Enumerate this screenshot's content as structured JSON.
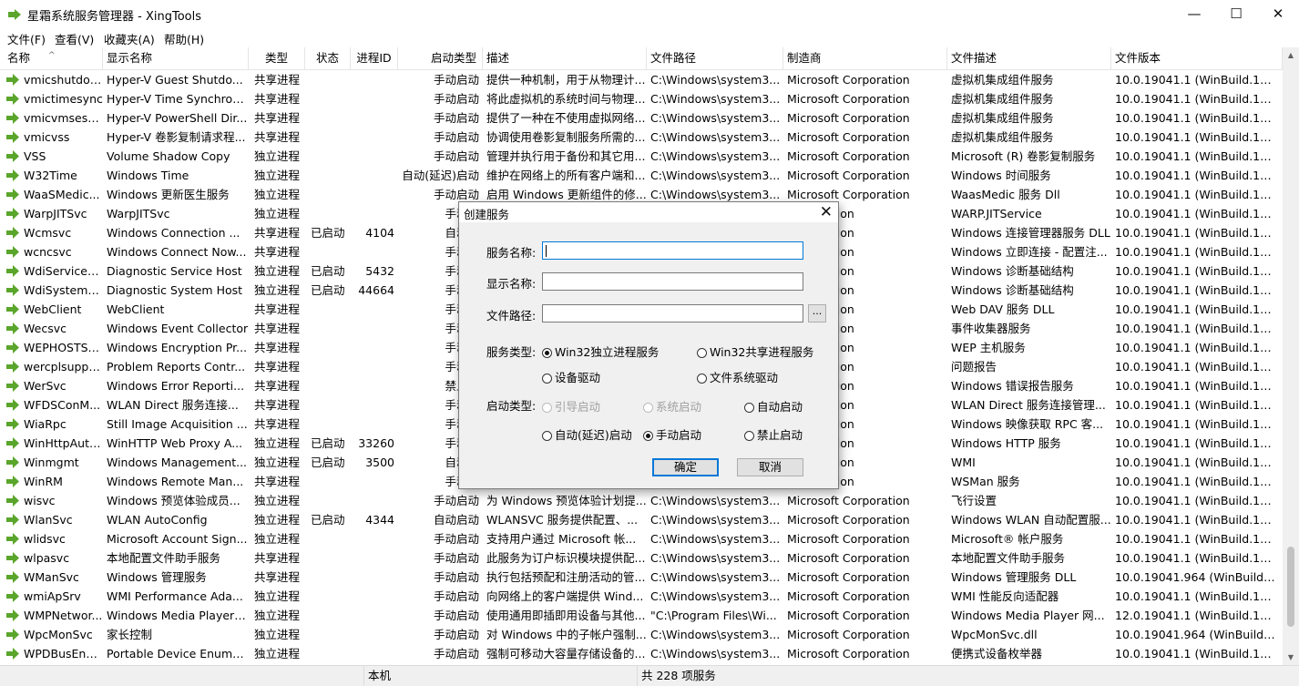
{
  "window": {
    "title": "星霜系统服务管理器 - XingTools"
  },
  "menu": [
    "文件(F)",
    "查看(V)",
    "收藏夹(A)",
    "帮助(H)"
  ],
  "columns": [
    "名称",
    "显示名称",
    "类型",
    "状态",
    "进程ID",
    "启动类型",
    "描述",
    "文件路径",
    "制造商",
    "文件描述",
    "文件版本"
  ],
  "rows": [
    [
      "vmicshutdown",
      "Hyper-V Guest Shutdo...",
      "共享进程",
      "",
      "",
      "手动启动",
      "提供一种机制，用于从物理计...",
      "C:\\Windows\\system3...",
      "Microsoft Corporation",
      "虚拟机集成组件服务",
      "10.0.19041.1 (WinBuild.160..."
    ],
    [
      "vmictimesync",
      "Hyper-V Time Synchron...",
      "共享进程",
      "",
      "",
      "手动启动",
      "将此虚拟机的系统时间与物理...",
      "C:\\Windows\\system3...",
      "Microsoft Corporation",
      "虚拟机集成组件服务",
      "10.0.19041.1 (WinBuild.160..."
    ],
    [
      "vmicvmsessi...",
      "Hyper-V PowerShell Dir...",
      "共享进程",
      "",
      "",
      "手动启动",
      "提供了一种在不使用虚拟网络...",
      "C:\\Windows\\system3...",
      "Microsoft Corporation",
      "虚拟机集成组件服务",
      "10.0.19041.1 (WinBuild.160..."
    ],
    [
      "vmicvss",
      "Hyper-V 卷影复制请求程...",
      "共享进程",
      "",
      "",
      "手动启动",
      "协调使用卷影复制服务所需的...",
      "C:\\Windows\\system3...",
      "Microsoft Corporation",
      "虚拟机集成组件服务",
      "10.0.19041.1 (WinBuild.160..."
    ],
    [
      "VSS",
      "Volume Shadow Copy",
      "独立进程",
      "",
      "",
      "手动启动",
      "管理并执行用于备份和其它用...",
      "C:\\Windows\\system3...",
      "Microsoft Corporation",
      "Microsoft (R) 卷影复制服务",
      "10.0.19041.1 (WinBuild.160..."
    ],
    [
      "W32Time",
      "Windows Time",
      "独立进程",
      "",
      "",
      "自动(延迟)启动",
      "维护在网络上的所有客户端和...",
      "C:\\Windows\\system3...",
      "Microsoft Corporation",
      "Windows 时间服务",
      "10.0.19041.1 (WinBuild.160..."
    ],
    [
      "WaaSMedic...",
      "Windows 更新医生服务",
      "独立进程",
      "",
      "",
      "手动启动",
      "启用 Windows 更新组件的修...",
      "C:\\Windows\\system3...",
      "Microsoft Corporation",
      "WaasMedic 服务 Dll",
      "10.0.19041.1 (WinBuild.160..."
    ],
    [
      "WarpJITSvc",
      "WarpJITSvc",
      "独立进程",
      "",
      "",
      "手动启",
      "",
      "",
      "Corporation",
      "WARP.JITService",
      "10.0.19041.1 (WinBuild.160..."
    ],
    [
      "Wcmsvc",
      "Windows Connection ...",
      "共享进程",
      "已启动",
      "4104",
      "自动启",
      "",
      "",
      "Corporation",
      "Windows 连接管理器服务 DLL",
      "10.0.19041.1 (WinBuild.160..."
    ],
    [
      "wcncsvc",
      "Windows Connect Now...",
      "共享进程",
      "",
      "",
      "手动启",
      "",
      "",
      "Corporation",
      "Windows 立即连接 - 配置注...",
      "10.0.19041.1 (WinBuild.160..."
    ],
    [
      "WdiServiceH...",
      "Diagnostic Service Host",
      "独立进程",
      "已启动",
      "5432",
      "手动启",
      "",
      "",
      "Corporation",
      "Windows 诊断基础结构",
      "10.0.19041.1 (WinBuild.160..."
    ],
    [
      "WdiSystemH...",
      "Diagnostic System Host",
      "独立进程",
      "已启动",
      "44664",
      "手动启",
      "",
      "",
      "Corporation",
      "Windows 诊断基础结构",
      "10.0.19041.1 (WinBuild.160..."
    ],
    [
      "WebClient",
      "WebClient",
      "共享进程",
      "",
      "",
      "手动启",
      "",
      "",
      "Corporation",
      "Web DAV 服务 DLL",
      "10.0.19041.1 (WinBuild.160..."
    ],
    [
      "Wecsvc",
      "Windows Event Collector",
      "共享进程",
      "",
      "",
      "手动启",
      "",
      "",
      "Corporation",
      "事件收集器服务",
      "10.0.19041.1 (WinBuild.160..."
    ],
    [
      "WEPHOSTSVC",
      "Windows Encryption Pr...",
      "共享进程",
      "",
      "",
      "手动启",
      "",
      "",
      "Corporation",
      "WEP 主机服务",
      "10.0.19041.1 (WinBuild.160..."
    ],
    [
      "wercplsupport",
      "Problem Reports Contr...",
      "共享进程",
      "",
      "",
      "手动启",
      "",
      "",
      "Corporation",
      "问题报告",
      "10.0.19041.1 (WinBuild.160..."
    ],
    [
      "WerSvc",
      "Windows Error Reporti...",
      "共享进程",
      "",
      "",
      "禁止启",
      "",
      "",
      "Corporation",
      "Windows 错误报告服务",
      "10.0.19041.1 (WinBuild.160..."
    ],
    [
      "WFDSConM...",
      "WLAN Direct 服务连接...",
      "共享进程",
      "",
      "",
      "手动启",
      "",
      "",
      "Corporation",
      "WLAN Direct 服务连接管理...",
      "10.0.19041.1 (WinBuild.160..."
    ],
    [
      "WiaRpc",
      "Still Image Acquisition ...",
      "共享进程",
      "",
      "",
      "手动启",
      "",
      "",
      "Corporation",
      "Windows 映像获取 RPC 客...",
      "10.0.19041.1 (WinBuild.160..."
    ],
    [
      "WinHttpAuto...",
      "WinHTTP Web Proxy A...",
      "独立进程",
      "已启动",
      "33260",
      "手动启",
      "",
      "",
      "Corporation",
      "Windows HTTP 服务",
      "10.0.19041.1 (WinBuild.160..."
    ],
    [
      "Winmgmt",
      "Windows Management...",
      "独立进程",
      "已启动",
      "3500",
      "自动启",
      "",
      "",
      "Corporation",
      "WMI",
      "10.0.19041.1 (WinBuild.160..."
    ],
    [
      "WinRM",
      "Windows Remote Man...",
      "共享进程",
      "",
      "",
      "手动启",
      "",
      "",
      "Corporation",
      "WSMan 服务",
      "10.0.19041.1 (WinBuild.160..."
    ],
    [
      "wisvc",
      "Windows 预览体验成员...",
      "独立进程",
      "",
      "",
      "手动启动",
      "为 Windows 预览体验计划提...",
      "C:\\Windows\\system3...",
      "Microsoft Corporation",
      "飞行设置",
      "10.0.19041.1 (WinBuild.160..."
    ],
    [
      "WlanSvc",
      "WLAN AutoConfig",
      "独立进程",
      "已启动",
      "4344",
      "自动启动",
      "WLANSVC 服务提供配置、...",
      "C:\\Windows\\system3...",
      "Microsoft Corporation",
      "Windows WLAN 自动配置服...",
      "10.0.19041.1 (WinBuild.160..."
    ],
    [
      "wlidsvc",
      "Microsoft Account Sign...",
      "独立进程",
      "",
      "",
      "手动启动",
      "支持用户通过 Microsoft 帐...",
      "C:\\Windows\\system3...",
      "Microsoft Corporation",
      "Microsoft® 帐户服务",
      "10.0.19041.1 (WinBuild.160..."
    ],
    [
      "wlpasvc",
      "本地配置文件助手服务",
      "共享进程",
      "",
      "",
      "手动启动",
      "此服务为订户标识模块提供配...",
      "C:\\Windows\\system3...",
      "Microsoft Corporation",
      "本地配置文件助手服务",
      "10.0.19041.1 (WinBuild.160..."
    ],
    [
      "WManSvc",
      "Windows 管理服务",
      "共享进程",
      "",
      "",
      "手动启动",
      "执行包括预配和注册活动的管...",
      "C:\\Windows\\system3...",
      "Microsoft Corporation",
      "Windows 管理服务 DLL",
      "10.0.19041.964 (WinBuild.1..."
    ],
    [
      "wmiApSrv",
      "WMI Performance Ada...",
      "独立进程",
      "",
      "",
      "手动启动",
      "向网络上的客户端提供 Wind...",
      "C:\\Windows\\system3...",
      "Microsoft Corporation",
      "WMI 性能反向适配器",
      "10.0.19041.1 (WinBuild.160..."
    ],
    [
      "WMPNetwor...",
      "Windows Media Player ...",
      "独立进程",
      "",
      "",
      "手动启动",
      "使用通用即插即用设备与其他...",
      "\"C:\\Program Files\\Wi...",
      "Microsoft Corporation",
      "Windows Media Player 网...",
      "12.0.19041.1 (WinBuild.160..."
    ],
    [
      "WpcMonSvc",
      "家长控制",
      "独立进程",
      "",
      "",
      "手动启动",
      "对 Windows 中的子帐户强制...",
      "C:\\Windows\\system3...",
      "Microsoft Corporation",
      "WpcMonSvc.dll",
      "10.0.19041.964 (WinBuild.1..."
    ],
    [
      "WPDBusEnum",
      "Portable Device Enume...",
      "独立进程",
      "",
      "",
      "手动启动",
      "强制可移动大容量存储设备的...",
      "C:\\Windows\\system3...",
      "Microsoft Corporation",
      "便携式设备枚举器",
      "10.0.19041.1 (WinBuild.160..."
    ]
  ],
  "status": {
    "location": "本机",
    "count": "共 228 项服务"
  },
  "dialog": {
    "title": "创建服务",
    "labels": {
      "service_name": "服务名称:",
      "display_name": "显示名称:",
      "file_path": "文件路径:",
      "service_type": "服务类型:",
      "start_type": "启动类型:"
    },
    "browse_label": "...",
    "service_type_options": [
      "Win32独立进程服务",
      "Win32共享进程服务",
      "设备驱动",
      "文件系统驱动"
    ],
    "start_type_options": [
      "引导启动",
      "系统启动",
      "自动启动",
      "自动(延迟)启动",
      "手动启动",
      "禁止启动"
    ],
    "ok_label": "确定",
    "cancel_label": "取消"
  },
  "colors": {
    "accent": "#0078d7",
    "icon_green": "#5aa52c"
  }
}
